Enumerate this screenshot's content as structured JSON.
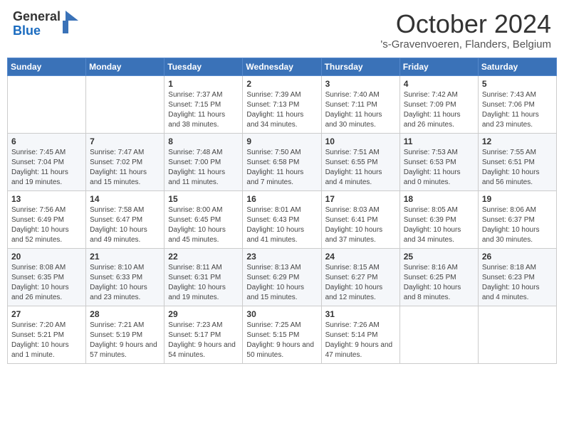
{
  "header": {
    "logo_general": "General",
    "logo_blue": "Blue",
    "month": "October 2024",
    "location": "'s-Gravenvoeren, Flanders, Belgium"
  },
  "weekdays": [
    "Sunday",
    "Monday",
    "Tuesday",
    "Wednesday",
    "Thursday",
    "Friday",
    "Saturday"
  ],
  "weeks": [
    [
      {
        "day": "",
        "sunrise": "",
        "sunset": "",
        "daylight": ""
      },
      {
        "day": "",
        "sunrise": "",
        "sunset": "",
        "daylight": ""
      },
      {
        "day": "1",
        "sunrise": "Sunrise: 7:37 AM",
        "sunset": "Sunset: 7:15 PM",
        "daylight": "Daylight: 11 hours and 38 minutes."
      },
      {
        "day": "2",
        "sunrise": "Sunrise: 7:39 AM",
        "sunset": "Sunset: 7:13 PM",
        "daylight": "Daylight: 11 hours and 34 minutes."
      },
      {
        "day": "3",
        "sunrise": "Sunrise: 7:40 AM",
        "sunset": "Sunset: 7:11 PM",
        "daylight": "Daylight: 11 hours and 30 minutes."
      },
      {
        "day": "4",
        "sunrise": "Sunrise: 7:42 AM",
        "sunset": "Sunset: 7:09 PM",
        "daylight": "Daylight: 11 hours and 26 minutes."
      },
      {
        "day": "5",
        "sunrise": "Sunrise: 7:43 AM",
        "sunset": "Sunset: 7:06 PM",
        "daylight": "Daylight: 11 hours and 23 minutes."
      }
    ],
    [
      {
        "day": "6",
        "sunrise": "Sunrise: 7:45 AM",
        "sunset": "Sunset: 7:04 PM",
        "daylight": "Daylight: 11 hours and 19 minutes."
      },
      {
        "day": "7",
        "sunrise": "Sunrise: 7:47 AM",
        "sunset": "Sunset: 7:02 PM",
        "daylight": "Daylight: 11 hours and 15 minutes."
      },
      {
        "day": "8",
        "sunrise": "Sunrise: 7:48 AM",
        "sunset": "Sunset: 7:00 PM",
        "daylight": "Daylight: 11 hours and 11 minutes."
      },
      {
        "day": "9",
        "sunrise": "Sunrise: 7:50 AM",
        "sunset": "Sunset: 6:58 PM",
        "daylight": "Daylight: 11 hours and 7 minutes."
      },
      {
        "day": "10",
        "sunrise": "Sunrise: 7:51 AM",
        "sunset": "Sunset: 6:55 PM",
        "daylight": "Daylight: 11 hours and 4 minutes."
      },
      {
        "day": "11",
        "sunrise": "Sunrise: 7:53 AM",
        "sunset": "Sunset: 6:53 PM",
        "daylight": "Daylight: 11 hours and 0 minutes."
      },
      {
        "day": "12",
        "sunrise": "Sunrise: 7:55 AM",
        "sunset": "Sunset: 6:51 PM",
        "daylight": "Daylight: 10 hours and 56 minutes."
      }
    ],
    [
      {
        "day": "13",
        "sunrise": "Sunrise: 7:56 AM",
        "sunset": "Sunset: 6:49 PM",
        "daylight": "Daylight: 10 hours and 52 minutes."
      },
      {
        "day": "14",
        "sunrise": "Sunrise: 7:58 AM",
        "sunset": "Sunset: 6:47 PM",
        "daylight": "Daylight: 10 hours and 49 minutes."
      },
      {
        "day": "15",
        "sunrise": "Sunrise: 8:00 AM",
        "sunset": "Sunset: 6:45 PM",
        "daylight": "Daylight: 10 hours and 45 minutes."
      },
      {
        "day": "16",
        "sunrise": "Sunrise: 8:01 AM",
        "sunset": "Sunset: 6:43 PM",
        "daylight": "Daylight: 10 hours and 41 minutes."
      },
      {
        "day": "17",
        "sunrise": "Sunrise: 8:03 AM",
        "sunset": "Sunset: 6:41 PM",
        "daylight": "Daylight: 10 hours and 37 minutes."
      },
      {
        "day": "18",
        "sunrise": "Sunrise: 8:05 AM",
        "sunset": "Sunset: 6:39 PM",
        "daylight": "Daylight: 10 hours and 34 minutes."
      },
      {
        "day": "19",
        "sunrise": "Sunrise: 8:06 AM",
        "sunset": "Sunset: 6:37 PM",
        "daylight": "Daylight: 10 hours and 30 minutes."
      }
    ],
    [
      {
        "day": "20",
        "sunrise": "Sunrise: 8:08 AM",
        "sunset": "Sunset: 6:35 PM",
        "daylight": "Daylight: 10 hours and 26 minutes."
      },
      {
        "day": "21",
        "sunrise": "Sunrise: 8:10 AM",
        "sunset": "Sunset: 6:33 PM",
        "daylight": "Daylight: 10 hours and 23 minutes."
      },
      {
        "day": "22",
        "sunrise": "Sunrise: 8:11 AM",
        "sunset": "Sunset: 6:31 PM",
        "daylight": "Daylight: 10 hours and 19 minutes."
      },
      {
        "day": "23",
        "sunrise": "Sunrise: 8:13 AM",
        "sunset": "Sunset: 6:29 PM",
        "daylight": "Daylight: 10 hours and 15 minutes."
      },
      {
        "day": "24",
        "sunrise": "Sunrise: 8:15 AM",
        "sunset": "Sunset: 6:27 PM",
        "daylight": "Daylight: 10 hours and 12 minutes."
      },
      {
        "day": "25",
        "sunrise": "Sunrise: 8:16 AM",
        "sunset": "Sunset: 6:25 PM",
        "daylight": "Daylight: 10 hours and 8 minutes."
      },
      {
        "day": "26",
        "sunrise": "Sunrise: 8:18 AM",
        "sunset": "Sunset: 6:23 PM",
        "daylight": "Daylight: 10 hours and 4 minutes."
      }
    ],
    [
      {
        "day": "27",
        "sunrise": "Sunrise: 7:20 AM",
        "sunset": "Sunset: 5:21 PM",
        "daylight": "Daylight: 10 hours and 1 minute."
      },
      {
        "day": "28",
        "sunrise": "Sunrise: 7:21 AM",
        "sunset": "Sunset: 5:19 PM",
        "daylight": "Daylight: 9 hours and 57 minutes."
      },
      {
        "day": "29",
        "sunrise": "Sunrise: 7:23 AM",
        "sunset": "Sunset: 5:17 PM",
        "daylight": "Daylight: 9 hours and 54 minutes."
      },
      {
        "day": "30",
        "sunrise": "Sunrise: 7:25 AM",
        "sunset": "Sunset: 5:15 PM",
        "daylight": "Daylight: 9 hours and 50 minutes."
      },
      {
        "day": "31",
        "sunrise": "Sunrise: 7:26 AM",
        "sunset": "Sunset: 5:14 PM",
        "daylight": "Daylight: 9 hours and 47 minutes."
      },
      {
        "day": "",
        "sunrise": "",
        "sunset": "",
        "daylight": ""
      },
      {
        "day": "",
        "sunrise": "",
        "sunset": "",
        "daylight": ""
      }
    ]
  ]
}
